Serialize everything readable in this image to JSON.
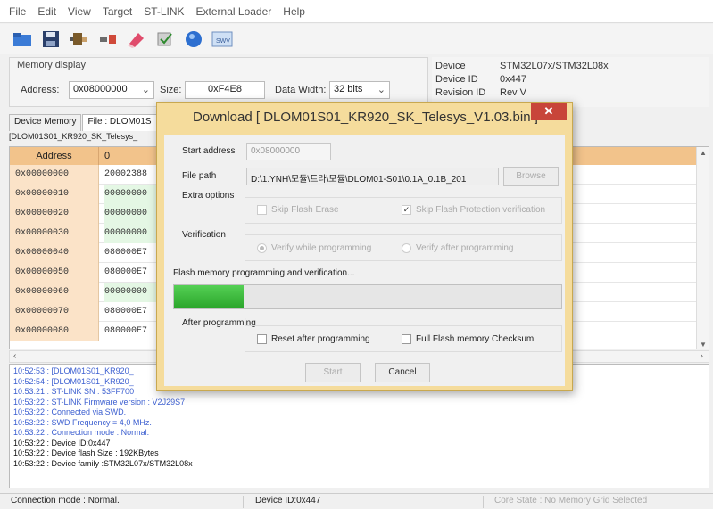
{
  "menu": [
    "File",
    "Edit",
    "View",
    "Target",
    "ST-LINK",
    "External Loader",
    "Help"
  ],
  "toolbar_icons": [
    "open-icon",
    "save-icon",
    "connect-icon",
    "disconnect-icon",
    "erase-icon",
    "program-verify-icon",
    "firmware-update-icon",
    "swv-icon"
  ],
  "swv_label": "SWV",
  "memory_display": {
    "title": "Memory display",
    "address_label": "Address:",
    "address_value": "0x08000000",
    "size_label": "Size:",
    "size_value": "0xF4E8",
    "width_label": "Data Width:",
    "width_value": "32 bits"
  },
  "device_info": {
    "device_label": "Device",
    "device_value": "STM32L07x/STM32L08x",
    "id_label": "Device ID",
    "id_value": "0x447",
    "rev_label": "Revision ID",
    "rev_value": "Rev V"
  },
  "tabs": [
    "Device Memory",
    "File : DLOM01S"
  ],
  "file_name": "[DLOM01S01_KR920_SK_Telesys_",
  "grid": {
    "header_address": "Address",
    "header_col0": "0",
    "rows": [
      {
        "addr": "0x00000000",
        "val": "20002388",
        "green": false
      },
      {
        "addr": "0x00000010",
        "val": "00000000",
        "green": true
      },
      {
        "addr": "0x00000020",
        "val": "00000000",
        "green": true
      },
      {
        "addr": "0x00000030",
        "val": "00000000",
        "green": true
      },
      {
        "addr": "0x00000040",
        "val": "080000E7",
        "green": false
      },
      {
        "addr": "0x00000050",
        "val": "080000E7",
        "green": false
      },
      {
        "addr": "0x00000060",
        "val": "00000000",
        "green": true
      },
      {
        "addr": "0x00000070",
        "val": "080000E7",
        "green": false
      },
      {
        "addr": "0x00000080",
        "val": "080000E7",
        "green": false
      }
    ]
  },
  "log": [
    {
      "text": "10:52:53 : [DLOM01S01_KR920_",
      "color": "blue"
    },
    {
      "text": "10:52:54 : [DLOM01S01_KR920_",
      "color": "blue"
    },
    {
      "text": "10:53:21 : ST-LINK SN : 53FF700",
      "color": "blue"
    },
    {
      "text": "10:53:22 : ST-LINK Firmware version : V2J29S7",
      "color": "blue"
    },
    {
      "text": "10:53:22 : Connected via SWD.",
      "color": "blue"
    },
    {
      "text": "10:53:22 : SWD Frequency = 4,0 MHz.",
      "color": "blue"
    },
    {
      "text": "10:53:22 : Connection mode : Normal.",
      "color": "blue"
    },
    {
      "text": "10:53:22 : Device ID:0x447",
      "color": "black"
    },
    {
      "text": "10:53:22 : Device flash Size : 192KBytes",
      "color": "black"
    },
    {
      "text": "10:53:22 : Device family :STM32L07x/STM32L08x",
      "color": "black"
    }
  ],
  "status": {
    "connection": "Connection mode : Normal.",
    "device_id": "Device ID:0x447",
    "core_state": "Core State : No Memory Grid Selected"
  },
  "dialog": {
    "title": "Download [ DLOM01S01_KR920_SK_Telesys_V1.03.bin ]",
    "close_glyph": "✕",
    "start_address_label": "Start address",
    "start_address_value": "0x08000000",
    "file_path_label": "File path",
    "file_path_value": "D:\\1.YNH\\모듈\\트라\\모듈\\DLOM01-S01\\0.1A_0.1B_201",
    "browse_label": "Browse",
    "extra_options_label": "Extra options",
    "skip_flash_erase": "Skip Flash Erase",
    "skip_flash_protection": "Skip Flash Protection verification",
    "verification_label": "Verification",
    "verify_while": "Verify while programming",
    "verify_after": "Verify after programming",
    "progress_text": "Flash memory programming and verification...",
    "progress_value": 0.18,
    "after_programming_label": "After programming",
    "reset_after": "Reset after programming",
    "full_checksum": "Full Flash memory Checksum",
    "start_label": "Start",
    "cancel_label": "Cancel"
  }
}
